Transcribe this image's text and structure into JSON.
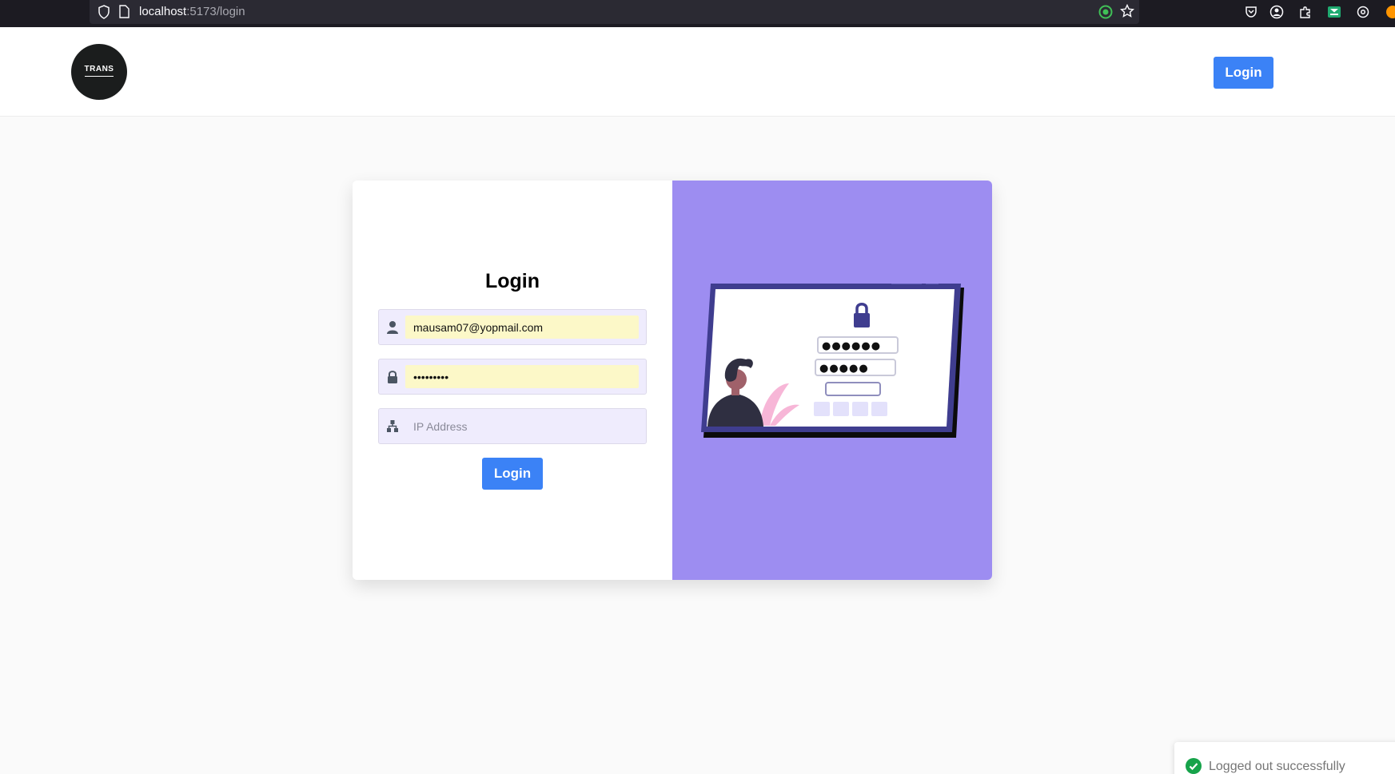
{
  "browser": {
    "url_host": "localhost",
    "url_path": ":5173/login",
    "icons": [
      "shield-icon",
      "page-icon",
      "extension-green-icon",
      "bookmark-star-icon",
      "pocket-icon",
      "account-icon",
      "extensions-icon",
      "mail-extension-icon",
      "settings-icon"
    ]
  },
  "header": {
    "logo_text": "TRANS",
    "login_label": "Login"
  },
  "form": {
    "title": "Login",
    "email_value": "mausam07@yopmail.com",
    "password_value": "mausam123",
    "ip_placeholder": "IP Address",
    "submit_label": "Login",
    "icons": [
      "user-icon",
      "lock-icon",
      "network-icon"
    ]
  },
  "illustration": {
    "password_mask_1": "●●●●●●",
    "password_mask_2": "●●●●●"
  },
  "toast": {
    "message": "Logged out successfully",
    "icon": "check-circle-icon"
  },
  "colors": {
    "primary": "#3b82f6",
    "panel": "#9d8df1",
    "input_bg": "#efecfd",
    "autofill": "#fcf8c8",
    "success": "#16a34a"
  }
}
